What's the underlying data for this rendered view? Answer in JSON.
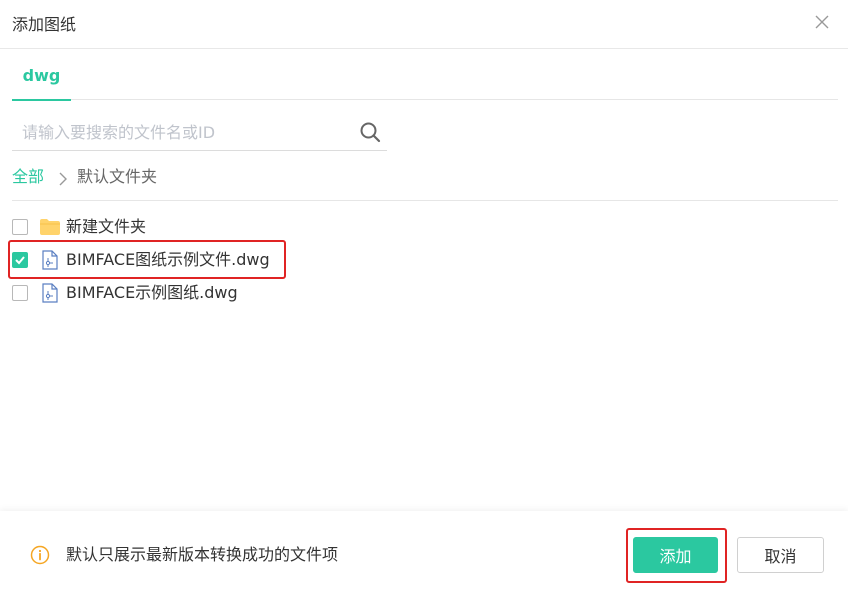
{
  "dialog": {
    "title": "添加图纸",
    "close_icon": "close-icon"
  },
  "tabs": [
    {
      "label": "dwg",
      "active": true
    }
  ],
  "search": {
    "placeholder": "请输入要搜索的文件名或ID",
    "value": "",
    "icon": "search-icon"
  },
  "breadcrumb": {
    "root": "全部",
    "separator_icon": "chevron-right-icon",
    "current": "默认文件夹"
  },
  "files": [
    {
      "name": "新建文件夹",
      "type": "folder",
      "icon": "folder-icon",
      "checked": false
    },
    {
      "name": "BIMFACE图纸示例文件.dwg",
      "type": "dwg",
      "icon": "dwg-file-icon",
      "checked": true,
      "highlighted": true
    },
    {
      "name": "BIMFACE示例图纸.dwg",
      "type": "dwg",
      "icon": "dwg-file-icon",
      "checked": false
    }
  ],
  "footer": {
    "info_icon": "info-icon",
    "note": "默认只展示最新版本转换成功的文件项",
    "confirm_label": "添加",
    "cancel_label": "取消"
  },
  "colors": {
    "accent": "#2bc8a0",
    "highlight": "#e02424",
    "info": "#f5a623"
  }
}
